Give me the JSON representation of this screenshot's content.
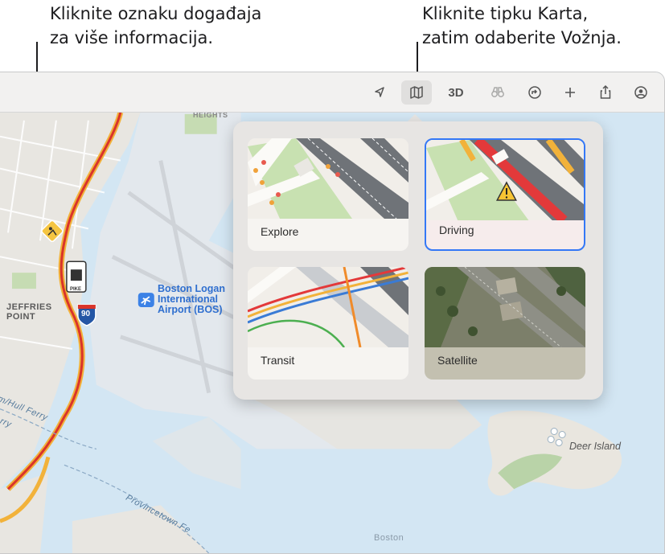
{
  "callouts": {
    "left": "Kliknite oznaku događaja\nza više informacija.",
    "right": "Kliknite tipku Karta,\nzatim odaberite Vožnja."
  },
  "toolbar": {
    "buttons": [
      {
        "name": "location-arrow-icon",
        "label": ""
      },
      {
        "name": "map-icon",
        "label": "",
        "active": true
      },
      {
        "name": "3d-button",
        "label": "3D"
      },
      {
        "name": "binoculars-icon",
        "label": ""
      },
      {
        "name": "directions-icon",
        "label": ""
      },
      {
        "name": "add-icon",
        "label": ""
      },
      {
        "name": "share-icon",
        "label": ""
      },
      {
        "name": "account-icon",
        "label": ""
      }
    ]
  },
  "map_types": {
    "explore": "Explore",
    "driving": "Driving",
    "transit": "Transit",
    "satellite": "Satellite",
    "selected": "Driving"
  },
  "map_labels": {
    "heights": "HEIGHTS",
    "jeffries_point": "JEFFRIES\nPOINT",
    "airport": "Boston Logan\nInternational\nAirport (BOS)",
    "deer_island": "Deer Island",
    "hull_ferry": "m/Hull Ferry",
    "ferry": "rry",
    "provincetown": "Provincetown Fe",
    "boston": "Boston",
    "highway_shield": "90",
    "pike_sign": "PIKE"
  },
  "colors": {
    "water": "#d3e6f3",
    "land": "#e9e8e4",
    "traffic_red": "#d9342b",
    "traffic_yellow": "#f2b23a",
    "selection": "#3478f6",
    "airport_blue": "#2f6fcf"
  }
}
